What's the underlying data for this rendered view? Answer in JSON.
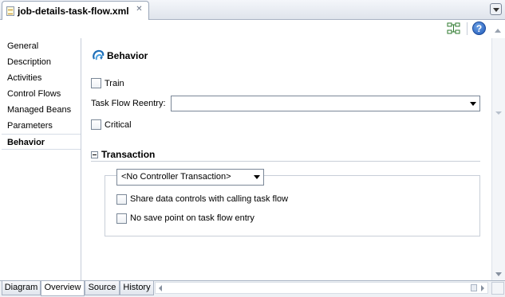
{
  "editor": {
    "file_tab_title": "job-details-task-flow.xml",
    "help_icon_label": "?"
  },
  "nav": {
    "items": [
      {
        "label": "General",
        "selected": false
      },
      {
        "label": "Description",
        "selected": false
      },
      {
        "label": "Activities",
        "selected": false
      },
      {
        "label": "Control Flows",
        "selected": false
      },
      {
        "label": "Managed Beans",
        "selected": false
      },
      {
        "label": "Parameters",
        "selected": false
      },
      {
        "label": "Behavior",
        "selected": true
      }
    ]
  },
  "behavior": {
    "title": "Behavior",
    "train_label": "Train",
    "train_checked": false,
    "reentry_label": "Task Flow Reentry:",
    "reentry_value": "",
    "critical_label": "Critical",
    "critical_checked": false
  },
  "transaction": {
    "title": "Transaction",
    "select_value": "<No Controller Transaction>",
    "share_label": "Share data controls with calling task flow",
    "share_checked": false,
    "nosave_label": "No save point on task flow entry",
    "nosave_checked": false
  },
  "bottom_tabs": [
    {
      "label": "Diagram",
      "selected": false
    },
    {
      "label": "Overview",
      "selected": true
    },
    {
      "label": "Source",
      "selected": false
    },
    {
      "label": "History",
      "selected": false
    }
  ],
  "colors": {
    "chrome": "#dfe4ec",
    "border": "#a9b3c3",
    "help_icon": "#1f58b8"
  }
}
